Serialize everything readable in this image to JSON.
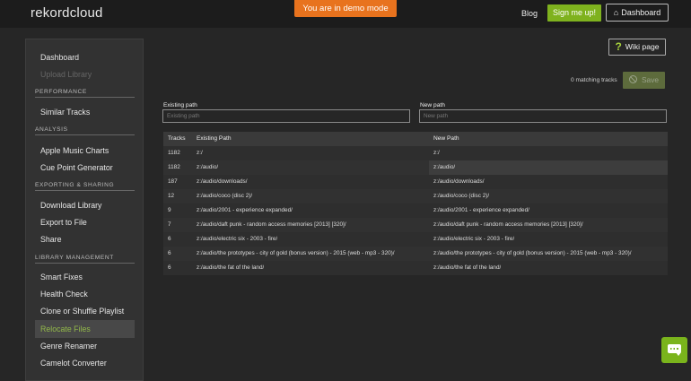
{
  "header": {
    "logo": "rekordcloud",
    "demo_banner": "You are in demo mode",
    "blog": "Blog",
    "signup": "Sign me up!",
    "dashboard": "Dashboard"
  },
  "sidebar": {
    "dashboard": "Dashboard",
    "upload_library": "Upload Library",
    "sections": {
      "performance": "PERFORMANCE",
      "analysis": "ANALYSIS",
      "exporting": "EXPORTING & SHARING",
      "library": "LIBRARY MANAGEMENT"
    },
    "items": {
      "similar_tracks": "Similar Tracks",
      "apple_music": "Apple Music Charts",
      "cue_point": "Cue Point Generator",
      "download_library": "Download Library",
      "export_to_file": "Export to File",
      "share": "Share",
      "smart_fixes": "Smart Fixes",
      "health_check": "Health Check",
      "clone_shuffle": "Clone or Shuffle Playlist",
      "relocate_files": "Relocate Files",
      "genre_renamer": "Genre Renamer",
      "camelot": "Camelot Converter"
    },
    "active_item": "Relocate Files"
  },
  "main": {
    "wiki": "Wiki page",
    "matching": "0 matching tracks",
    "save": "Save",
    "existing_label": "Existing path",
    "existing_placeholder": "Existing path",
    "new_label": "New path",
    "new_placeholder": "New path",
    "table": {
      "headers": [
        "Tracks",
        "Existing Path",
        "New Path"
      ],
      "rows": [
        {
          "tracks": "1182",
          "existing": "z:/",
          "new": "z:/"
        },
        {
          "tracks": "1182",
          "existing": "z:/audio/",
          "new": "z:/audio/"
        },
        {
          "tracks": "187",
          "existing": "z:/audio/downloads/",
          "new": "z:/audio/downloads/"
        },
        {
          "tracks": "12",
          "existing": "z:/audio/coco (disc 2)/",
          "new": "z:/audio/coco (disc 2)/"
        },
        {
          "tracks": "9",
          "existing": "z:/audio/2001 - experience expanded/",
          "new": "z:/audio/2001 - experience expanded/"
        },
        {
          "tracks": "7",
          "existing": "z:/audio/daft punk - random access memories [2013] [320]/",
          "new": "z:/audio/daft punk - random access memories [2013] [320]/"
        },
        {
          "tracks": "6",
          "existing": "z:/audio/electric six - 2003 - fire/",
          "new": "z:/audio/electric six - 2003 - fire/"
        },
        {
          "tracks": "6",
          "existing": "z:/audio/the prototypes - city of gold (bonus version) - 2015 (web - mp3 - 320)/",
          "new": "z:/audio/the prototypes - city of gold (bonus version) - 2015 (web - mp3 - 320)/"
        },
        {
          "tracks": "6",
          "existing": "z:/audio/the fat of the land/",
          "new": "z:/audio/the fat of the land/"
        }
      ]
    }
  },
  "colors": {
    "accent_green": "#7fb21e",
    "demo_orange": "#e8731e",
    "active_text": "#93b94a"
  }
}
